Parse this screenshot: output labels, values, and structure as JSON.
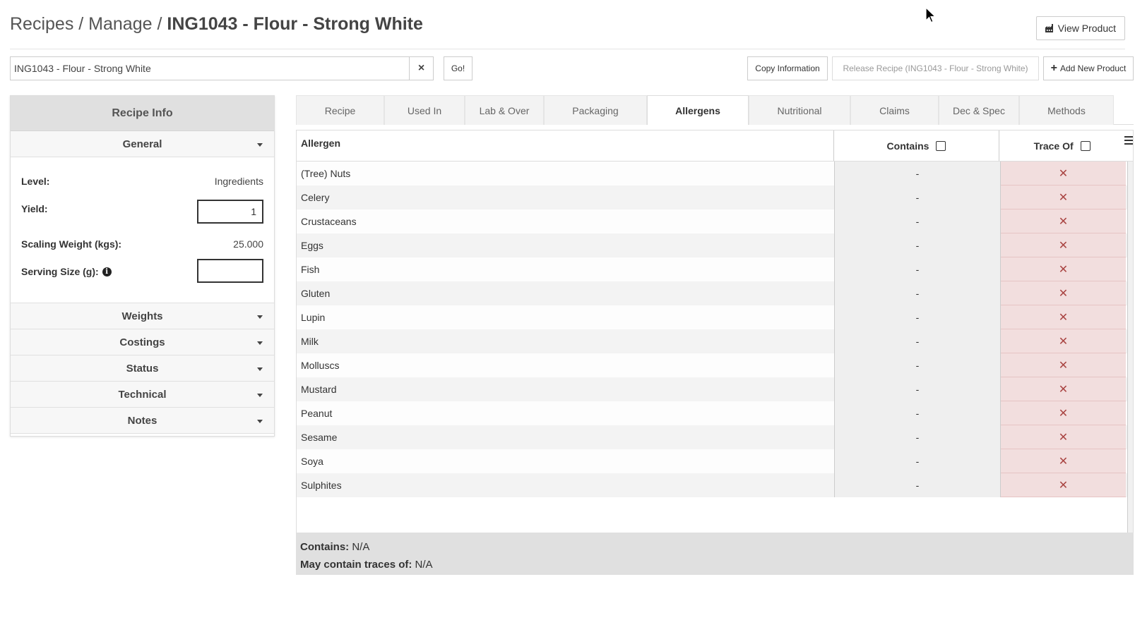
{
  "header": {
    "breadcrumb_recipes": "Recipes",
    "breadcrumb_sep": " / ",
    "breadcrumb_manage": "Manage",
    "breadcrumb_current": "ING1043 - Flour - Strong White",
    "view_product_label": "View Product"
  },
  "toolbar": {
    "search_value": "ING1043 - Flour - Strong White",
    "clear_label": "×",
    "go_label": "Go!",
    "copy_label": "Copy Information",
    "release_label": "Release Recipe (ING1043 - Flour - Strong White)",
    "add_label": "Add New Product"
  },
  "sidebar": {
    "title": "Recipe Info",
    "general": {
      "label": "General",
      "level_label": "Level:",
      "level_value": "Ingredients",
      "yield_label": "Yield:",
      "yield_value": "1",
      "scaling_label": "Scaling Weight (kgs):",
      "scaling_value": "25.000",
      "serving_label": "Serving Size (g):",
      "serving_value": ""
    },
    "sections": [
      "Weights",
      "Costings",
      "Status",
      "Technical",
      "Notes"
    ]
  },
  "tabs": [
    {
      "label": "Recipe",
      "active": false
    },
    {
      "label": "Used In",
      "active": false
    },
    {
      "label": "Lab & Over",
      "active": false
    },
    {
      "label": "Packaging",
      "active": false
    },
    {
      "label": "Allergens",
      "active": true
    },
    {
      "label": "Nutritional",
      "active": false
    },
    {
      "label": "Claims",
      "active": false
    },
    {
      "label": "Dec & Spec",
      "active": false
    },
    {
      "label": "Methods",
      "active": false
    }
  ],
  "table": {
    "col_allergen": "Allergen",
    "col_contains": "Contains",
    "col_trace": "Trace Of",
    "rows": [
      {
        "allergen": "(Tree) Nuts",
        "contains": "-",
        "trace": "✕"
      },
      {
        "allergen": "Celery",
        "contains": "-",
        "trace": "✕"
      },
      {
        "allergen": "Crustaceans",
        "contains": "-",
        "trace": "✕"
      },
      {
        "allergen": "Eggs",
        "contains": "-",
        "trace": "✕"
      },
      {
        "allergen": "Fish",
        "contains": "-",
        "trace": "✕"
      },
      {
        "allergen": "Gluten",
        "contains": "-",
        "trace": "✕"
      },
      {
        "allergen": "Lupin",
        "contains": "-",
        "trace": "✕"
      },
      {
        "allergen": "Milk",
        "contains": "-",
        "trace": "✕"
      },
      {
        "allergen": "Molluscs",
        "contains": "-",
        "trace": "✕"
      },
      {
        "allergen": "Mustard",
        "contains": "-",
        "trace": "✕"
      },
      {
        "allergen": "Peanut",
        "contains": "-",
        "trace": "✕"
      },
      {
        "allergen": "Sesame",
        "contains": "-",
        "trace": "✕"
      },
      {
        "allergen": "Soya",
        "contains": "-",
        "trace": "✕"
      },
      {
        "allergen": "Sulphites",
        "contains": "-",
        "trace": "✕"
      }
    ]
  },
  "summary": {
    "contains_label": "Contains:",
    "contains_value": "N/A",
    "traces_label": "May contain traces of:",
    "traces_value": "N/A"
  },
  "colors": {
    "trace_bg": "#f2dede",
    "trace_x": "#a94442",
    "header_bg": "#e0e0e0"
  }
}
